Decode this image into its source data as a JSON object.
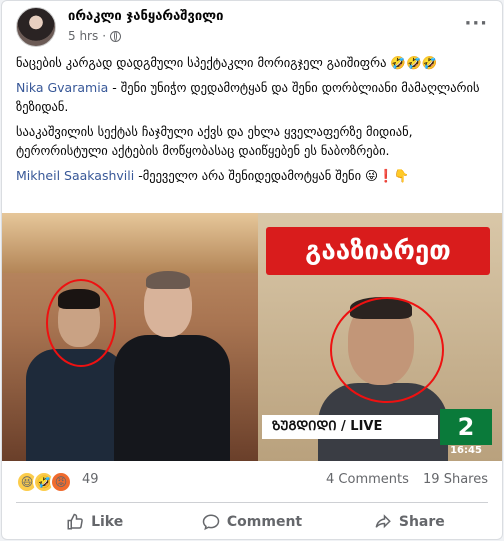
{
  "post": {
    "author": "ირაკლი ჯანყარაშვილი",
    "time": "5 hrs",
    "more_label": "···",
    "text": {
      "line1": "ნაცების კარგად დადგმული სპექტაკლი მორიგჯელ გაიშიფრა 🤣🤣🤣",
      "mention1": "Nika Gvaramia",
      "line2_rest": " - შენი უნიჭო დედამოტყან და შენი დორბლიანი მამაღლარის ზეზიდან.",
      "line3": "სააკაშვილის სექტას ჩაჯმული აქვს და ეხლა ყველაფერზე მიდიან, ტერორისტული აქტების მოწყობასაც დაიწყებენ ეს ნაბოზრები.",
      "mention2": "Mikheil Saakashvili",
      "line4_rest": " -მეეველო არა შენიდედამოტყან შენი 😜❗👇"
    },
    "image": {
      "banner": "გააზიარეთ",
      "live_label": "ᲖᲣᲒᲓᲘᲓᲘ / LIVE",
      "logo": "2",
      "clock": "16:45"
    },
    "reactions": {
      "icons": [
        "haha-icon",
        "haha-icon",
        "angry-icon"
      ],
      "count": "49",
      "comments": "4 Comments",
      "shares": "19 Shares"
    },
    "actions": {
      "like": "Like",
      "comment": "Comment",
      "share": "Share"
    }
  }
}
